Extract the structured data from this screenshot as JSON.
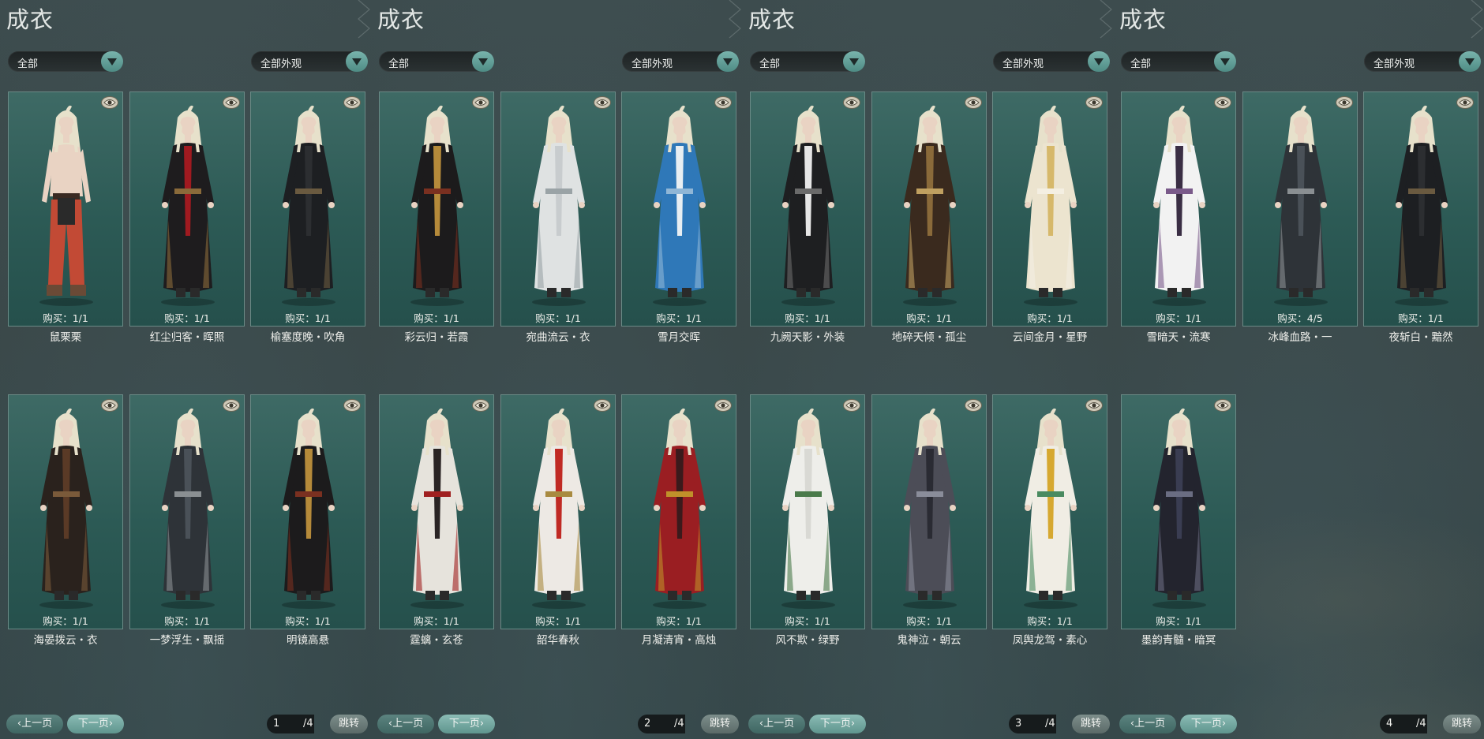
{
  "panels": [
    {
      "title": "成衣",
      "filter_category": "全部",
      "filter_appearance": "全部外观",
      "items": [
        {
          "name": "鼠栗栗",
          "buy": "购买：1/1",
          "outfit": "bare"
        },
        {
          "name": "红尘归客・晖照",
          "buy": "购买：1/1",
          "outfit": "blackred"
        },
        {
          "name": "榆塞度晚・吹角",
          "buy": "购买：1/1",
          "outfit": "black"
        },
        {
          "name": "海晏拨云・衣",
          "buy": "购买：1/1",
          "outfit": "brownblack"
        },
        {
          "name": "一梦浮生・飘摇",
          "buy": "购买：1/1",
          "outfit": "darkgray"
        },
        {
          "name": "明镜高悬",
          "buy": "购买：1/1",
          "outfit": "blackgold"
        }
      ],
      "prev_label": "上一页",
      "next_label": "下一页",
      "page": "1",
      "total": "/4",
      "jump_label": "跳转"
    },
    {
      "title": "成衣",
      "filter_category": "全部",
      "filter_appearance": "全部外观",
      "items": [
        {
          "name": "彩云归・若霞",
          "buy": "购买：1/1",
          "outfit": "blackgold"
        },
        {
          "name": "宛曲流云・衣",
          "buy": "购买：1/1",
          "outfit": "white"
        },
        {
          "name": "雪月交晖",
          "buy": "购买：1/1",
          "outfit": "blue"
        },
        {
          "name": "霆螭・玄苍",
          "buy": "购买：1/1",
          "outfit": "whiteblackred"
        },
        {
          "name": "韶华春秋",
          "buy": "购买：1/1",
          "outfit": "whitered"
        },
        {
          "name": "月凝清宵・高烛",
          "buy": "购买：1/1",
          "outfit": "red"
        }
      ],
      "prev_label": "上一页",
      "next_label": "下一页",
      "page": "2",
      "total": "/4",
      "jump_label": "跳转"
    },
    {
      "title": "成衣",
      "filter_category": "全部",
      "filter_appearance": "全部外观",
      "items": [
        {
          "name": "九阙天影・外装",
          "buy": "购买：1/1",
          "outfit": "blackwhite"
        },
        {
          "name": "地碎天倾・孤尘",
          "buy": "购买：1/1",
          "outfit": "brown"
        },
        {
          "name": "云间金月・星野",
          "buy": "购买：1/1",
          "outfit": "cream"
        },
        {
          "name": "风不欺・绿野",
          "buy": "购买：1/1",
          "outfit": "whiteplain"
        },
        {
          "name": "鬼神泣・朝云",
          "buy": "购买：1/1",
          "outfit": "armor"
        },
        {
          "name": "凤舆龙驾・素心",
          "buy": "购买：1/1",
          "outfit": "whitegold"
        }
      ],
      "prev_label": "上一页",
      "next_label": "下一页",
      "page": "3",
      "total": "/4",
      "jump_label": "跳转"
    },
    {
      "title": "成衣",
      "filter_category": "全部",
      "filter_appearance": "全部外观",
      "items": [
        {
          "name": "雪暗天・流寒",
          "buy": "购买：1/1",
          "outfit": "whitepurple"
        },
        {
          "name": "冰峰血路・一",
          "buy": "购买：4/5",
          "outfit": "darkgray"
        },
        {
          "name": "夜斩白・黯然",
          "buy": "购买：1/1",
          "outfit": "black"
        },
        {
          "name": "墨韵青髓・暗冥",
          "buy": "购买：1/1",
          "outfit": "navy"
        }
      ],
      "prev_label": "上一页",
      "next_label": "下一页",
      "page": "4",
      "total": "/4",
      "jump_label": "跳转"
    }
  ],
  "icons": {
    "dropdown": "chevron-down-icon",
    "preview": "eye-icon",
    "prev": "chevron-left-icon",
    "next": "chevron-right-icon"
  },
  "colors": {
    "accent": "#5f958e",
    "card_bg": "#2c5a55",
    "text": "#f0f0ec"
  }
}
